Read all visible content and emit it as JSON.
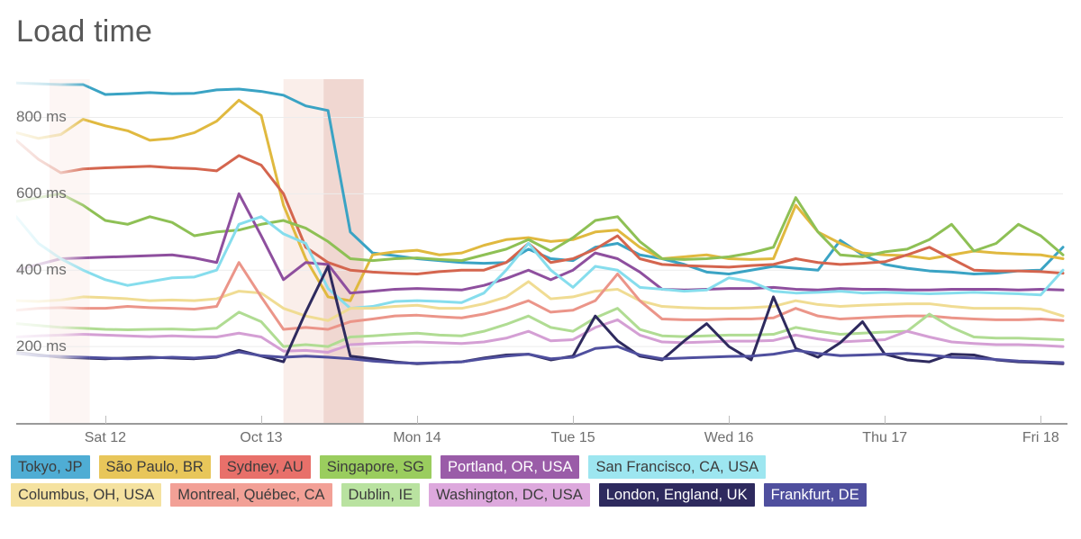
{
  "header": {
    "title": "Load time"
  },
  "chart_data": {
    "type": "line",
    "title": "Load time",
    "xlabel": "",
    "ylabel": "",
    "ylim": [
      0,
      900
    ],
    "xlim": [
      0,
      47
    ],
    "grid": true,
    "legend_position": "bottom",
    "y_ticks": [
      200,
      400,
      600,
      800
    ],
    "y_tick_labels": [
      "200 ms",
      "400 ms",
      "600 ms",
      "800 ms"
    ],
    "x_tick_positions": [
      4,
      11,
      18,
      25,
      32,
      39,
      46
    ],
    "x_tick_labels": [
      "Sat 12",
      "Oct 13",
      "Mon 14",
      "Tue 15",
      "Wed 16",
      "Thu 17",
      "Fri 18"
    ],
    "x_indices": [
      0,
      1,
      2,
      3,
      4,
      5,
      6,
      7,
      8,
      9,
      10,
      11,
      12,
      13,
      14,
      15,
      16,
      17,
      18,
      19,
      20,
      21,
      22,
      23,
      24,
      25,
      26,
      27,
      28,
      29,
      30,
      31,
      32,
      33,
      34,
      35,
      36,
      37,
      38,
      39,
      40,
      41,
      42,
      43,
      44,
      45,
      46,
      47
    ],
    "highlight_bands": [
      {
        "start": 1.5,
        "end": 3.3,
        "color": "#fdf6f4",
        "label": "faint-band"
      },
      {
        "start": 12.0,
        "end": 13.8,
        "color": "#faeeea",
        "label": "light-band"
      },
      {
        "start": 13.8,
        "end": 15.6,
        "color": "#f0d7d1",
        "label": "dark-band"
      }
    ],
    "fade_before_index": 3.3,
    "series": [
      {
        "name": "Tokyo, JP",
        "color": "#3aa3c4",
        "values": [
          890,
          888,
          886,
          886,
          860,
          862,
          865,
          862,
          863,
          872,
          874,
          868,
          858,
          830,
          818,
          500,
          445,
          438,
          430,
          425,
          420,
          418,
          420,
          455,
          430,
          425,
          460,
          470,
          440,
          430,
          415,
          395,
          390,
          400,
          410,
          405,
          400,
          478,
          440,
          415,
          405,
          398,
          395,
          390,
          392,
          398,
          400,
          460
        ]
      },
      {
        "name": "São Paulo, BR",
        "color": "#e0b93f",
        "values": [
          760,
          745,
          755,
          795,
          778,
          765,
          740,
          745,
          760,
          790,
          845,
          805,
          570,
          430,
          330,
          320,
          440,
          448,
          452,
          440,
          445,
          465,
          480,
          485,
          475,
          480,
          500,
          505,
          460,
          430,
          435,
          440,
          430,
          428,
          430,
          570,
          500,
          470,
          445,
          440,
          438,
          430,
          440,
          450,
          445,
          442,
          440,
          430
        ]
      },
      {
        "name": "Sydney, AU",
        "color": "#d4654e",
        "values": [
          740,
          690,
          655,
          665,
          668,
          670,
          672,
          668,
          666,
          660,
          700,
          675,
          600,
          460,
          420,
          400,
          395,
          392,
          390,
          396,
          400,
          400,
          420,
          470,
          420,
          430,
          455,
          490,
          430,
          415,
          412,
          410,
          408,
          412,
          415,
          430,
          420,
          415,
          418,
          422,
          440,
          460,
          430,
          400,
          398,
          398,
          396,
          392
        ]
      },
      {
        "name": "Singapore, SG",
        "color": "#8ec055",
        "values": [
          580,
          590,
          600,
          570,
          530,
          520,
          540,
          525,
          490,
          500,
          505,
          520,
          530,
          510,
          475,
          430,
          425,
          430,
          432,
          428,
          425,
          440,
          455,
          480,
          450,
          485,
          530,
          540,
          475,
          430,
          428,
          430,
          435,
          445,
          460,
          590,
          500,
          440,
          435,
          448,
          455,
          480,
          520,
          450,
          470,
          520,
          490,
          440
        ]
      },
      {
        "name": "Portland, OR, USA",
        "color": "#8e4f9e",
        "values": [
          400,
          415,
          430,
          432,
          434,
          436,
          438,
          440,
          432,
          420,
          600,
          490,
          375,
          420,
          415,
          340,
          345,
          350,
          352,
          350,
          348,
          360,
          378,
          400,
          375,
          400,
          445,
          430,
          395,
          350,
          348,
          350,
          352,
          352,
          355,
          350,
          348,
          352,
          350,
          350,
          348,
          348,
          350,
          350,
          350,
          348,
          350,
          348
        ]
      },
      {
        "name": "San Francisco, CA, USA",
        "color": "#86dded",
        "values": [
          540,
          470,
          430,
          400,
          375,
          360,
          370,
          380,
          382,
          400,
          520,
          540,
          495,
          470,
          352,
          300,
          305,
          318,
          320,
          318,
          315,
          340,
          400,
          470,
          400,
          355,
          410,
          400,
          355,
          350,
          345,
          348,
          380,
          370,
          345,
          340,
          342,
          345,
          340,
          342,
          340,
          338,
          340,
          342,
          340,
          338,
          335,
          400
        ]
      },
      {
        "name": "Columbus, OH, USA",
        "color": "#f0dc93",
        "values": [
          320,
          318,
          322,
          330,
          328,
          325,
          320,
          322,
          320,
          325,
          345,
          340,
          300,
          280,
          268,
          300,
          300,
          305,
          308,
          300,
          300,
          312,
          330,
          370,
          325,
          330,
          345,
          350,
          320,
          305,
          302,
          300,
          300,
          302,
          305,
          320,
          310,
          305,
          308,
          310,
          312,
          312,
          305,
          300,
          300,
          300,
          298,
          280
        ]
      },
      {
        "name": "Montreal, Québec, CA",
        "color": "#eb9589",
        "values": [
          295,
          300,
          302,
          300,
          300,
          305,
          302,
          300,
          298,
          305,
          420,
          330,
          245,
          250,
          245,
          265,
          272,
          280,
          282,
          278,
          275,
          285,
          300,
          320,
          290,
          295,
          320,
          390,
          320,
          272,
          270,
          270,
          272,
          272,
          275,
          300,
          280,
          272,
          275,
          278,
          280,
          280,
          275,
          272,
          270,
          270,
          272,
          268
        ]
      },
      {
        "name": "Dublin, IE",
        "color": "#b0dc93",
        "values": [
          260,
          255,
          250,
          248,
          245,
          244,
          245,
          246,
          244,
          248,
          290,
          265,
          200,
          205,
          200,
          225,
          228,
          232,
          235,
          230,
          228,
          240,
          258,
          280,
          250,
          240,
          275,
          300,
          245,
          228,
          226,
          228,
          230,
          230,
          232,
          250,
          240,
          232,
          235,
          238,
          240,
          285,
          250,
          225,
          222,
          222,
          220,
          218
        ]
      },
      {
        "name": "Washington, DC, USA",
        "color": "#d49fd4",
        "values": [
          225,
          228,
          230,
          232,
          230,
          228,
          226,
          228,
          226,
          225,
          235,
          225,
          188,
          190,
          185,
          205,
          208,
          210,
          212,
          210,
          208,
          212,
          222,
          240,
          215,
          218,
          250,
          270,
          230,
          212,
          210,
          212,
          214,
          214,
          216,
          230,
          220,
          212,
          215,
          218,
          240,
          225,
          212,
          208,
          205,
          205,
          203,
          200
        ]
      },
      {
        "name": "London, England, UK",
        "color": "#2e2a5e",
        "values": [
          185,
          178,
          172,
          170,
          168,
          170,
          172,
          170,
          168,
          172,
          190,
          175,
          160,
          290,
          410,
          175,
          168,
          160,
          155,
          158,
          160,
          170,
          178,
          180,
          165,
          175,
          280,
          215,
          175,
          165,
          215,
          260,
          200,
          165,
          330,
          195,
          172,
          210,
          265,
          180,
          165,
          160,
          180,
          178,
          165,
          160,
          158,
          155
        ]
      },
      {
        "name": "Frankfurt, DE",
        "color": "#4f4f9e",
        "values": [
          182,
          176,
          174,
          172,
          170,
          168,
          170,
          172,
          170,
          174,
          186,
          176,
          172,
          175,
          172,
          168,
          162,
          158,
          156,
          158,
          160,
          168,
          175,
          180,
          168,
          172,
          195,
          200,
          178,
          168,
          170,
          172,
          174,
          175,
          180,
          190,
          182,
          176,
          178,
          180,
          182,
          178,
          172,
          170,
          166,
          162,
          160,
          158
        ]
      }
    ]
  },
  "legend": {
    "rows": [
      [
        {
          "label": "Tokyo, JP",
          "bg": "#4fadd4",
          "fg": "#3c3c3c"
        },
        {
          "label": "São Paulo, BR",
          "bg": "#e8c65a",
          "fg": "#3c3c3c"
        },
        {
          "label": "Sydney, AU",
          "bg": "#e8706a",
          "fg": "#3c3c3c"
        },
        {
          "label": "Singapore, SG",
          "bg": "#9acd5e",
          "fg": "#3c3c3c"
        },
        {
          "label": "Portland, OR, USA",
          "bg": "#9a5ca8",
          "fg": "#ffffff"
        },
        {
          "label": "San Francisco, CA, USA",
          "bg": "#9de6f0",
          "fg": "#3c3c3c"
        }
      ],
      [
        {
          "label": "Columbus, OH, USA",
          "bg": "#f5e2a0",
          "fg": "#3c3c3c"
        },
        {
          "label": "Montreal, Québec, CA",
          "bg": "#f2a096",
          "fg": "#3c3c3c"
        },
        {
          "label": "Dublin, IE",
          "bg": "#b9e2a0",
          "fg": "#3c3c3c"
        },
        {
          "label": "Washington, DC, USA",
          "bg": "#dda8dd",
          "fg": "#3c3c3c"
        },
        {
          "label": "London, England, UK",
          "bg": "#2e2a5e",
          "fg": "#ffffff"
        },
        {
          "label": "Frankfurt, DE",
          "bg": "#4f4f9e",
          "fg": "#ffffff"
        }
      ]
    ]
  }
}
